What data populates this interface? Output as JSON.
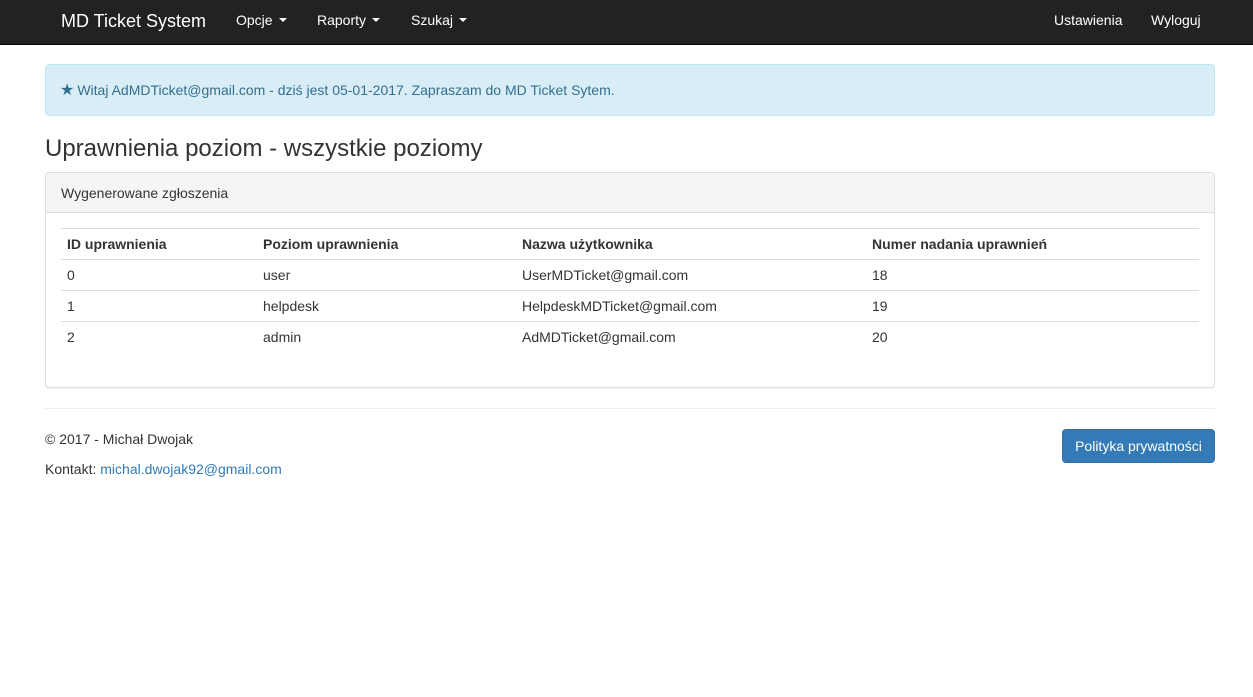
{
  "navbar": {
    "brand": "MD Ticket System",
    "menus": [
      {
        "label": "Opcje"
      },
      {
        "label": "Raporty"
      },
      {
        "label": "Szukaj"
      }
    ],
    "right": {
      "settings": "Ustawienia",
      "logout": "Wyloguj"
    }
  },
  "alert": {
    "icon": "star-icon",
    "text": "Witaj AdMDTicket@gmail.com - dziś jest 05-01-2017. Zapraszam do MD Ticket Sytem."
  },
  "page": {
    "title": "Uprawnienia poziom - wszystkie poziomy"
  },
  "panel": {
    "heading": "Wygenerowane zgłoszenia",
    "table": {
      "headers": [
        "ID uprawnienia",
        "Poziom uprawnienia",
        "Nazwa użytkownika",
        "Numer nadania uprawnień"
      ],
      "rows": [
        [
          "0",
          "user",
          "UserMDTicket@gmail.com",
          "18"
        ],
        [
          "1",
          "helpdesk",
          "HelpdeskMDTicket@gmail.com",
          "19"
        ],
        [
          "2",
          "admin",
          "AdMDTicket@gmail.com",
          "20"
        ]
      ]
    }
  },
  "footer": {
    "copyright": "© 2017 - Michał Dwojak",
    "contact_label": "Kontakt:",
    "contact_email": "michal.dwojak92@gmail.com",
    "privacy_button": "Polityka prywatności"
  },
  "colors": {
    "navbar_bg": "#222222",
    "alert_bg": "#d9edf7",
    "alert_text": "#31708f",
    "link": "#337ab7",
    "primary_button": "#337ab7"
  }
}
